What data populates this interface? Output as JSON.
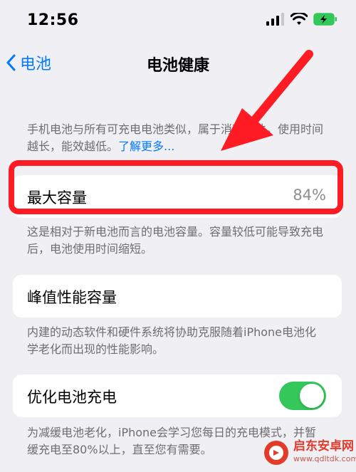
{
  "status": {
    "time": "12:56"
  },
  "nav": {
    "back_label": "电池",
    "title": "电池健康"
  },
  "intro": {
    "text": "手机电池与所有可充电电池类似，属于消耗部件。使用时间越长，能效越低。",
    "link": "了解更多..."
  },
  "max_capacity": {
    "label": "最大容量",
    "value": "84%",
    "footnote": "这是相对于新电池而言的电池容量。容量较低可能导致充电后，电池使用时间缩短。"
  },
  "peak": {
    "label": "峰值性能容量",
    "footnote": "内建的动态软件和硬件系统将协助克服随着iPhone电池化学老化而出现的性能影响。"
  },
  "optimized": {
    "label": "优化电池充电",
    "enabled": true,
    "footnote": "为减缓电池老化，iPhone会学习您每日的充电模式，并暂缓充电至80%以上，直至您有需要。"
  },
  "watermark": {
    "name": "启东安卓网",
    "url": "www.qdltdk.com"
  },
  "colors": {
    "accent": "#007aff",
    "toggle_on": "#34c759",
    "highlight": "#ff1b24"
  }
}
